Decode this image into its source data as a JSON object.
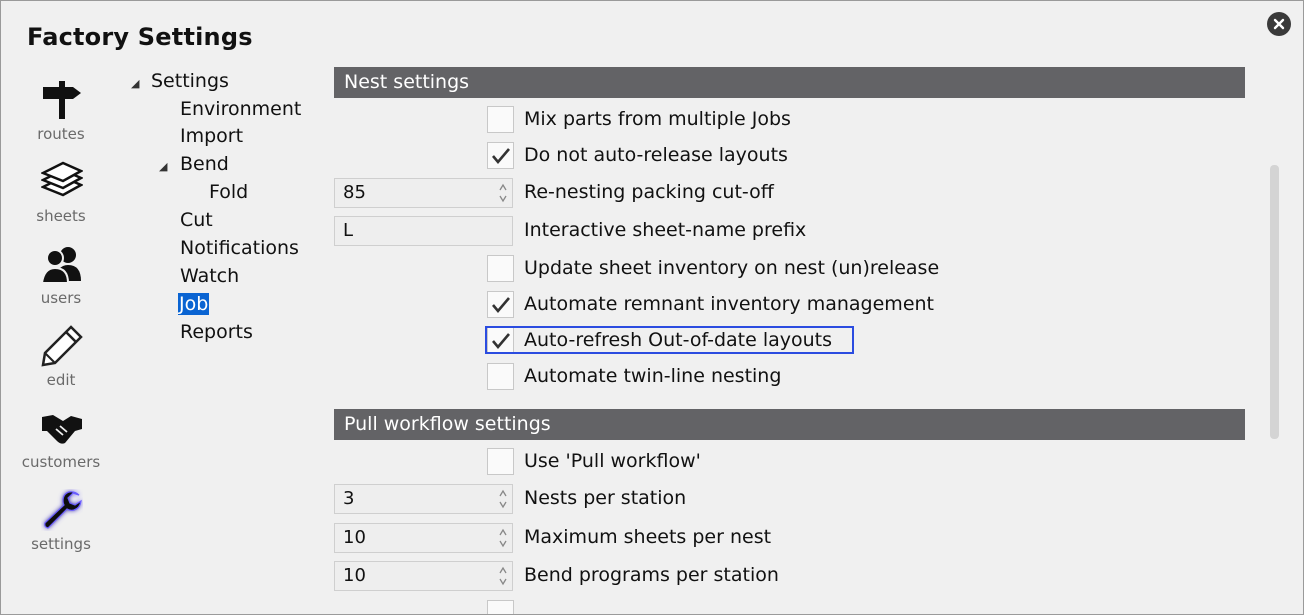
{
  "window": {
    "title": "Factory Settings"
  },
  "nav": [
    {
      "label": "routes",
      "icon": "signpost-icon"
    },
    {
      "label": "sheets",
      "icon": "sheets-stack-icon"
    },
    {
      "label": "users",
      "icon": "users-icon"
    },
    {
      "label": "edit",
      "icon": "pencil-icon"
    },
    {
      "label": "customers",
      "icon": "handshake-icon"
    },
    {
      "label": "settings",
      "icon": "wrench-icon",
      "active": true
    }
  ],
  "tree": {
    "root": "Settings",
    "items": [
      "Environment",
      "Import",
      "Bend",
      "Fold",
      "Cut",
      "Notifications",
      "Watch",
      "Job",
      "Reports"
    ],
    "selected": "Job"
  },
  "nest_settings": {
    "header": "Nest settings",
    "rows": [
      {
        "label": "Mix parts from multiple Jobs",
        "type": "checkbox",
        "checked": false
      },
      {
        "label": "Do not auto-release layouts",
        "type": "checkbox",
        "checked": true
      },
      {
        "label": "Re-nesting packing cut-off",
        "type": "spinner",
        "value": "85"
      },
      {
        "label": "Interactive sheet-name prefix",
        "type": "text",
        "value": "L"
      },
      {
        "label": "Update sheet inventory on nest (un)release",
        "type": "checkbox",
        "checked": false
      },
      {
        "label": "Automate remnant inventory management",
        "type": "checkbox",
        "checked": true
      },
      {
        "label": "Auto-refresh Out-of-date layouts",
        "type": "checkbox",
        "checked": true,
        "focused": true
      },
      {
        "label": "Automate twin-line nesting",
        "type": "checkbox",
        "checked": false
      }
    ]
  },
  "pull_settings": {
    "header": "Pull workflow settings",
    "rows": [
      {
        "label": "Use 'Pull workflow'",
        "type": "checkbox",
        "checked": false
      },
      {
        "label": "Nests per station",
        "type": "spinner",
        "value": "3"
      },
      {
        "label": "Maximum sheets per nest",
        "type": "spinner",
        "value": "10"
      },
      {
        "label": "Bend programs per station",
        "type": "spinner",
        "value": "10"
      }
    ]
  },
  "colors": {
    "header_bg": "#636366",
    "selection": "#0a64d2",
    "focus": "#2b4ce0",
    "active_icon_glow": "#6a5cff"
  }
}
